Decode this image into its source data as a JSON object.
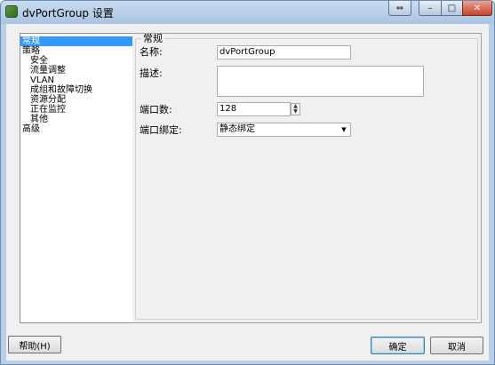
{
  "window": {
    "title": "dvPortGroup 设置",
    "controls": {
      "restore": "⇔",
      "minimize": "–",
      "maximize": "□",
      "close": "✕"
    }
  },
  "tree": {
    "items": [
      {
        "label": "常规",
        "level": 0,
        "selected": true
      },
      {
        "label": "策略",
        "level": 0,
        "selected": false
      },
      {
        "label": "安全",
        "level": 1,
        "selected": false
      },
      {
        "label": "流量调整",
        "level": 1,
        "selected": false
      },
      {
        "label": "VLAN",
        "level": 1,
        "selected": false
      },
      {
        "label": "成组和故障切换",
        "level": 1,
        "selected": false
      },
      {
        "label": "资源分配",
        "level": 1,
        "selected": false
      },
      {
        "label": "正在监控",
        "level": 1,
        "selected": false
      },
      {
        "label": "其他",
        "level": 1,
        "selected": false
      },
      {
        "label": "高级",
        "level": 0,
        "selected": false
      }
    ]
  },
  "general": {
    "group_title": "常规",
    "name_label": "名称:",
    "name_value": "dvPortGroup",
    "description_label": "描述:",
    "description_value": "",
    "ports_label": "端口数:",
    "ports_value": "128",
    "binding_label": "端口绑定:",
    "binding_value": "静态绑定"
  },
  "footer": {
    "help_label": "帮助(H)",
    "ok_label": "确定",
    "cancel_label": "取消"
  },
  "colors": {
    "selection": "#3399ff",
    "titlebar": "#b9cfe6",
    "close_button": "#c5442b"
  }
}
